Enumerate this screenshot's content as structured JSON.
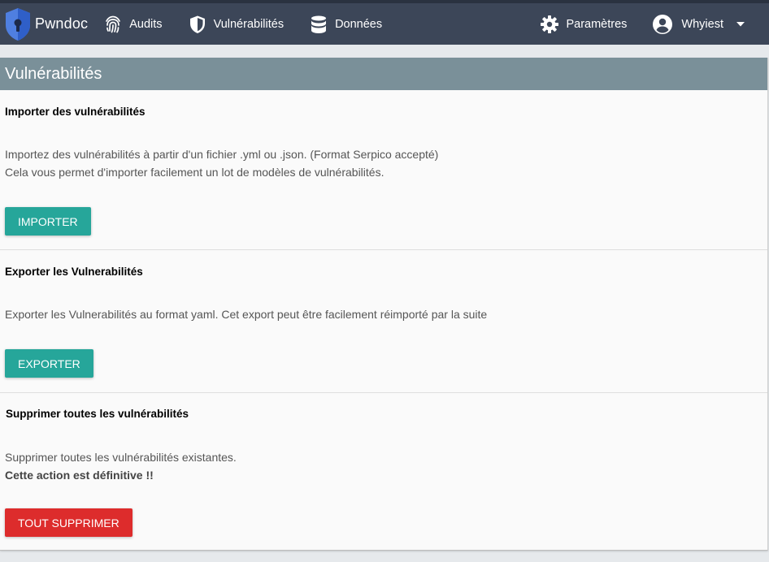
{
  "navbar": {
    "brand": "Pwndoc",
    "items": [
      {
        "label": "Audits",
        "icon": "fingerprint-icon"
      },
      {
        "label": "Vulnérabilités",
        "icon": "shield-icon"
      },
      {
        "label": "Données",
        "icon": "database-icon"
      }
    ],
    "settings_label": "Paramètres",
    "user_label": "Whyiest"
  },
  "page": {
    "title": "Vulnérabilités",
    "sections": [
      {
        "title": "Importer des vulnérabilités",
        "lines": [
          "Importez des vulnérabilités à partir d'un fichier .yml ou .json. (Format Serpico accepté)",
          "Cela vous permet d'importer facilement un lot de modèles de vulnérabilités."
        ],
        "button": "IMPORTER"
      },
      {
        "title": "Exporter les Vulnerabilités",
        "lines": [
          "Exporter les Vulnerabilités au format yaml. Cet export peut être facilement réimporté par la suite"
        ],
        "button": "EXPORTER"
      },
      {
        "title": "Supprimer toutes les vulnérabilités",
        "lines": [
          "Supprimer toutes les vulnérabilités existantes.",
          "Cette action est définitive !!"
        ],
        "button": "TOUT SUPPRIMER"
      }
    ]
  },
  "colors": {
    "navbar": "#3c4658",
    "header": "#7a9099",
    "teal": "#26a69a",
    "danger": "#dd2c2c"
  }
}
